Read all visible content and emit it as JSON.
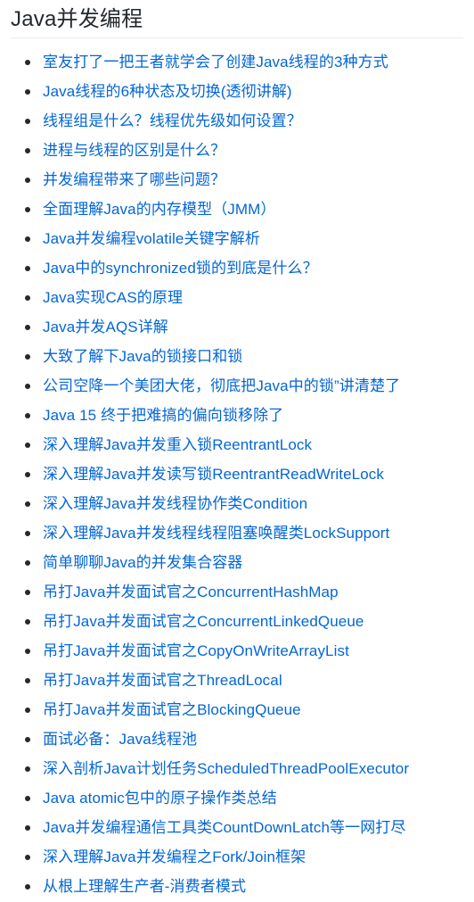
{
  "page": {
    "title": "Java并发编程"
  },
  "articles": [
    "室友打了一把王者就学会了创建Java线程的3种方式",
    "Java线程的6种状态及切换(透彻讲解)",
    "线程组是什么？线程优先级如何设置？",
    "进程与线程的区别是什么？",
    "并发编程带来了哪些问题？",
    "全面理解Java的内存模型（JMM）",
    "Java并发编程volatile关键字解析",
    "Java中的synchronized锁的到底是什么？",
    "Java实现CAS的原理",
    "Java并发AQS详解",
    "大致了解下Java的锁接口和锁",
    "公司空降一个美团大佬，彻底把Java中的锁”讲清楚了",
    "Java 15 终于把难搞的偏向锁移除了",
    "深入理解Java并发重入锁ReentrantLock",
    "深入理解Java并发读写锁ReentrantReadWriteLock",
    "深入理解Java并发线程协作类Condition",
    "深入理解Java并发线程线程阻塞唤醒类LockSupport",
    "简单聊聊Java的并发集合容器",
    "吊打Java并发面试官之ConcurrentHashMap",
    "吊打Java并发面试官之ConcurrentLinkedQueue",
    "吊打Java并发面试官之CopyOnWriteArrayList",
    "吊打Java并发面试官之ThreadLocal",
    "吊打Java并发面试官之BlockingQueue",
    "面试必备：Java线程池",
    "深入剖析Java计划任务ScheduledThreadPoolExecutor",
    "Java atomic包中的原子操作类总结",
    "Java并发编程通信工具类CountDownLatch等一网打尽",
    "深入理解Java并发编程之Fork/Join框架",
    "从根上理解生产者-消费者模式"
  ],
  "colors": {
    "link": "#0366d6",
    "text": "#24292e",
    "divider": "#eaecef"
  }
}
